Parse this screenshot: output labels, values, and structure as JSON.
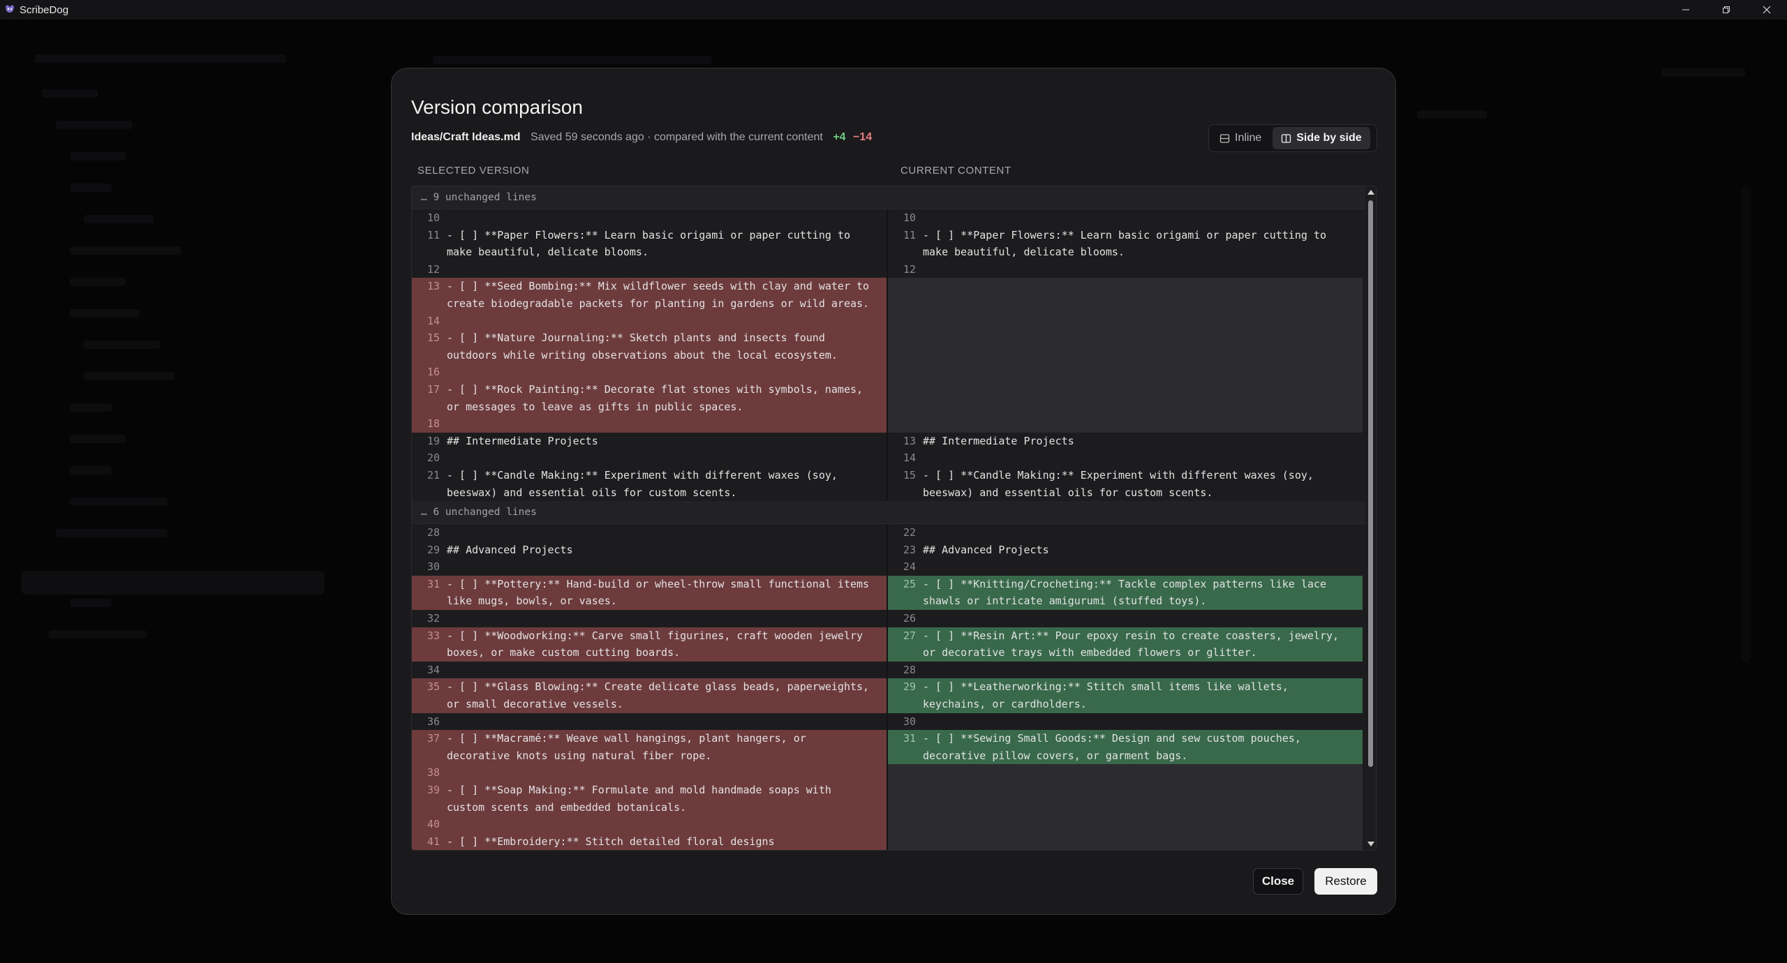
{
  "app": {
    "title": "ScribeDog"
  },
  "dialog": {
    "title": "Version comparison",
    "file_path": "Ideas/Craft Ideas.md",
    "saved_text": "Saved 59 seconds ago · compared with the current content",
    "added_count": "+4",
    "removed_count": "−14",
    "view_modes": {
      "inline": "Inline",
      "side_by_side": "Side by side",
      "active": "side_by_side"
    },
    "left_header": "SELECTED VERSION",
    "right_header": "CURRENT CONTENT",
    "close_label": "Close",
    "restore_label": "Restore"
  },
  "diff_blocks": [
    {
      "kind": "collapsed",
      "label": "… 9 unchanged lines"
    },
    {
      "kind": "lines",
      "rows": [
        {
          "left": {
            "num": "10",
            "text": "",
            "type": "same"
          },
          "right": {
            "num": "10",
            "text": "",
            "type": "same"
          }
        },
        {
          "left": {
            "num": "11",
            "text": "- [ ] **Paper Flowers:** Learn basic origami or paper cutting to make beautiful, delicate blooms.",
            "type": "same"
          },
          "right": {
            "num": "11",
            "text": "- [ ] **Paper Flowers:** Learn basic origami or paper cutting to make beautiful, delicate blooms.",
            "type": "same"
          }
        },
        {
          "left": {
            "num": "12",
            "text": "",
            "type": "same"
          },
          "right": {
            "num": "12",
            "text": "",
            "type": "same"
          }
        },
        {
          "left": {
            "num": "13",
            "text": "- [ ] **Seed Bombing:** Mix wildflower seeds with clay and water to create biodegradable packets for planting in gardens or wild areas.",
            "type": "del"
          },
          "right": {
            "type": "empty"
          }
        },
        {
          "left": {
            "num": "14",
            "text": "",
            "type": "del"
          },
          "right": {
            "type": "empty"
          }
        },
        {
          "left": {
            "num": "15",
            "text": "- [ ] **Nature Journaling:** Sketch plants and insects found outdoors while writing observations about the local ecosystem.",
            "type": "del"
          },
          "right": {
            "type": "empty"
          }
        },
        {
          "left": {
            "num": "16",
            "text": "",
            "type": "del"
          },
          "right": {
            "type": "empty"
          }
        },
        {
          "left": {
            "num": "17",
            "text": "- [ ] **Rock Painting:** Decorate flat stones with symbols, names, or messages to leave as gifts in public spaces.",
            "type": "del"
          },
          "right": {
            "type": "empty"
          }
        },
        {
          "left": {
            "num": "18",
            "text": "",
            "type": "del"
          },
          "right": {
            "type": "empty"
          }
        },
        {
          "left": {
            "num": "19",
            "text": "## Intermediate Projects",
            "type": "same"
          },
          "right": {
            "num": "13",
            "text": "## Intermediate Projects",
            "type": "same"
          }
        },
        {
          "left": {
            "num": "20",
            "text": "",
            "type": "same"
          },
          "right": {
            "num": "14",
            "text": "",
            "type": "same"
          }
        },
        {
          "left": {
            "num": "21",
            "text": "- [ ] **Candle Making:** Experiment with different waxes (soy, beeswax) and essential oils for custom scents.",
            "type": "same"
          },
          "right": {
            "num": "15",
            "text": "- [ ] **Candle Making:** Experiment with different waxes (soy, beeswax) and essential oils for custom scents.",
            "type": "same"
          }
        }
      ]
    },
    {
      "kind": "collapsed",
      "label": "… 6 unchanged lines"
    },
    {
      "kind": "lines",
      "rows": [
        {
          "left": {
            "num": "28",
            "text": "",
            "type": "same"
          },
          "right": {
            "num": "22",
            "text": "",
            "type": "same"
          }
        },
        {
          "left": {
            "num": "29",
            "text": "## Advanced Projects",
            "type": "same"
          },
          "right": {
            "num": "23",
            "text": "## Advanced Projects",
            "type": "same"
          }
        },
        {
          "left": {
            "num": "30",
            "text": "",
            "type": "same"
          },
          "right": {
            "num": "24",
            "text": "",
            "type": "same"
          }
        },
        {
          "left": {
            "num": "31",
            "text": "- [ ] **Pottery:** Hand-build or wheel-throw small functional items like mugs, bowls, or vases.",
            "type": "del"
          },
          "right": {
            "num": "25",
            "text": "- [ ] **Knitting/Crocheting:** Tackle complex patterns like lace shawls or intricate amigurumi (stuffed toys).",
            "type": "add"
          }
        },
        {
          "left": {
            "num": "32",
            "text": "",
            "type": "same"
          },
          "right": {
            "num": "26",
            "text": "",
            "type": "same"
          }
        },
        {
          "left": {
            "num": "33",
            "text": "- [ ] **Woodworking:** Carve small figurines, craft wooden jewelry boxes, or make custom cutting boards.",
            "type": "del"
          },
          "right": {
            "num": "27",
            "text": "- [ ] **Resin Art:** Pour epoxy resin to create coasters, jewelry, or decorative trays with embedded flowers or glitter.",
            "type": "add"
          }
        },
        {
          "left": {
            "num": "34",
            "text": "",
            "type": "same"
          },
          "right": {
            "num": "28",
            "text": "",
            "type": "same"
          }
        },
        {
          "left": {
            "num": "35",
            "text": "- [ ] **Glass Blowing:** Create delicate glass beads, paperweights, or small decorative vessels.",
            "type": "del"
          },
          "right": {
            "num": "29",
            "text": "- [ ] **Leatherworking:** Stitch small items like wallets, keychains, or cardholders.",
            "type": "add"
          }
        },
        {
          "left": {
            "num": "36",
            "text": "",
            "type": "same"
          },
          "right": {
            "num": "30",
            "text": "",
            "type": "same"
          }
        },
        {
          "left": {
            "num": "37",
            "text": "- [ ] **Macramé:** Weave wall hangings, plant hangers, or decorative knots using natural fiber rope.",
            "type": "del"
          },
          "right": {
            "num": "31",
            "text": "- [ ] **Sewing Small Goods:** Design and sew custom pouches, decorative pillow covers, or garment bags.",
            "type": "add"
          }
        },
        {
          "left": {
            "num": "38",
            "text": "",
            "type": "del"
          },
          "right": {
            "type": "empty"
          }
        },
        {
          "left": {
            "num": "39",
            "text": "- [ ] **Soap Making:** Formulate and mold handmade soaps with custom scents and embedded botanicals.",
            "type": "del"
          },
          "right": {
            "type": "empty"
          }
        },
        {
          "left": {
            "num": "40",
            "text": "",
            "type": "del"
          },
          "right": {
            "type": "empty"
          }
        },
        {
          "left": {
            "num": "41",
            "text": "- [ ] **Embroidery:** Stitch detailed floral designs",
            "type": "del"
          },
          "right": {
            "type": "empty"
          }
        }
      ]
    }
  ]
}
